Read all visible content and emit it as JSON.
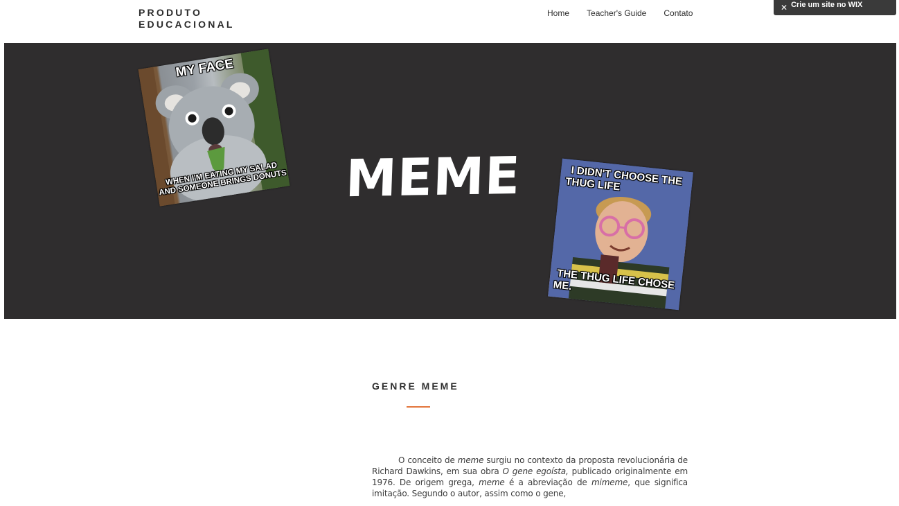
{
  "header": {
    "logo_line1": "PRODUTO",
    "logo_line2": "EDUCACIONAL",
    "nav": [
      {
        "label": "Home"
      },
      {
        "label": "Teacher's Guide"
      },
      {
        "label": "Contato"
      }
    ],
    "wix_banner": {
      "close_icon": "close-icon",
      "label": "Crie um site no WIX"
    }
  },
  "hero": {
    "title": "MEME",
    "background": "#2f2d2e",
    "memes": [
      {
        "top": "MY FACE",
        "bottom_line1": "WHEN I'M EATING MY SALAD",
        "bottom_line2": "AND SOMEONE BRINGS DONUTS"
      },
      {
        "top_line1": "I DIDN'T CHOOSE THE",
        "top_line2": "THUG LIFE",
        "bottom_line1": "THE THUG LIFE CHOSE",
        "bottom_line2": "ME."
      }
    ]
  },
  "content": {
    "section_title": "GENRE MEME",
    "accent_color": "#e3763c",
    "p1": "O conceito de ",
    "p1_em1": "meme",
    "p1_b": " surgiu no contexto da proposta revolucionária de Richard Dawkins, em sua obra ",
    "p1_em2": "O gene egoísta,",
    "p1_c": " publicado originalmente em 1976. De origem grega, ",
    "p1_em3": "meme",
    "p1_d": " é a abreviação de ",
    "p1_em4": "mimeme",
    "p1_e": ", que significa imitação. Segundo o autor, assim como o gene,"
  }
}
